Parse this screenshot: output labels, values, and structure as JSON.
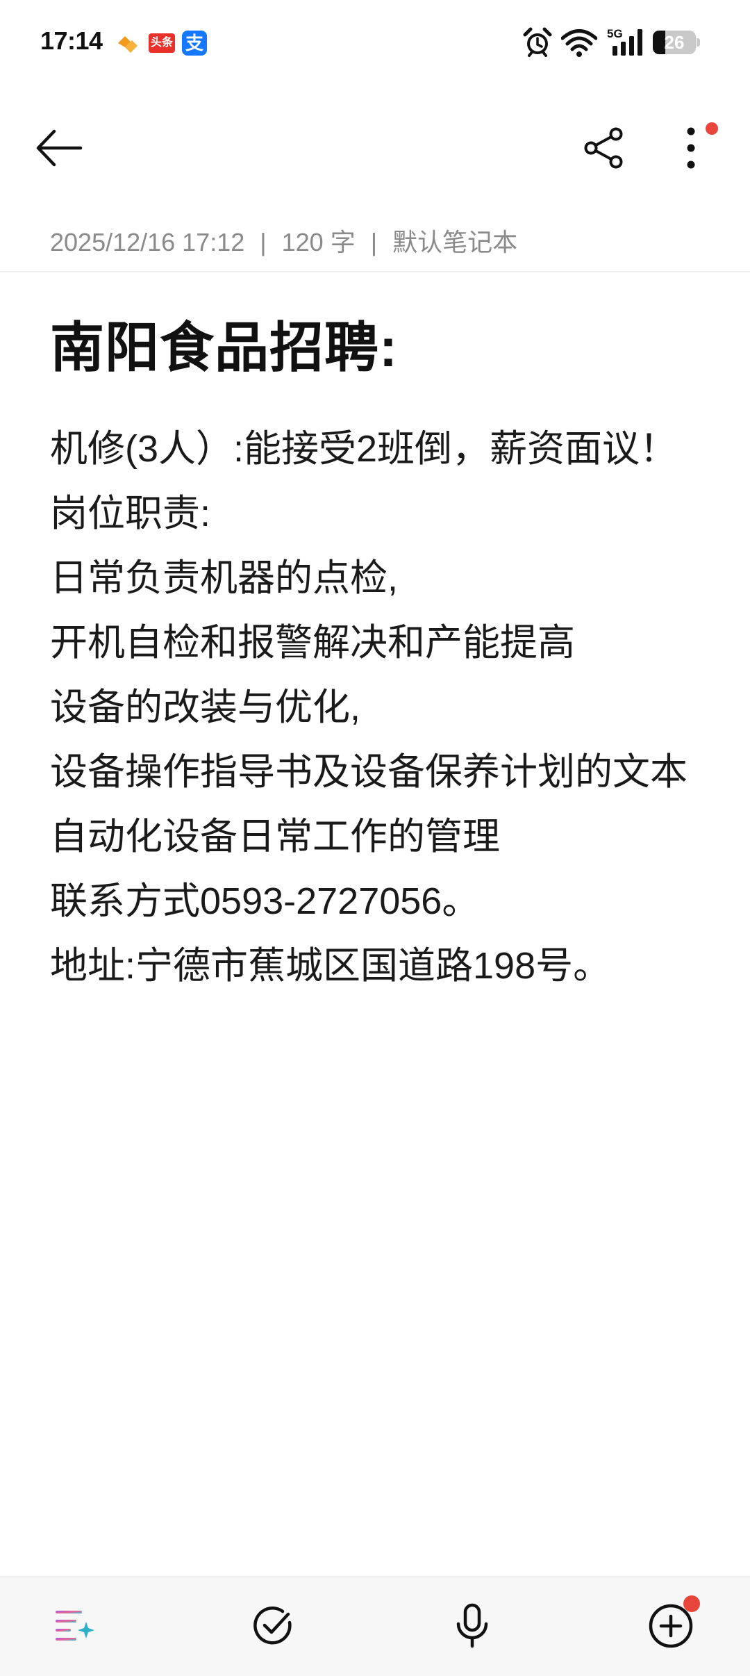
{
  "status_bar": {
    "time": "17:14",
    "app_icons": [
      "huawei-health-icon",
      "toutiao-icon",
      "alipay-icon"
    ],
    "toutiao_label": "头条",
    "alipay_label": "支",
    "network": "5G",
    "battery_level": "26",
    "right_icons": [
      "alarm-icon",
      "wifi-icon",
      "signal-icon",
      "battery-icon"
    ]
  },
  "toolbar": {
    "icons": [
      "back-arrow-icon",
      "share-icon",
      "more-vertical-icon"
    ],
    "more_has_badge": true
  },
  "meta": {
    "datetime": "2025/12/16 17:12",
    "word_count": "120 字",
    "notebook": "默认笔记本",
    "separator": "|"
  },
  "note": {
    "title": "南阳食品招聘:",
    "lines": [
      "机修(3人）:能接受2班倒，薪资面议！",
      "岗位职责:",
      "日常负责机器的点检,",
      "开机自检和报警解决和产能提高",
      "设备的改装与优化,",
      "设备操作指导书及设备保养计划的文本",
      "自动化设备日常工作的管理",
      "联系方式0593-2727056。",
      "地址:宁德市蕉城区国道路198号。"
    ]
  },
  "bottom_bar": {
    "icons": [
      "ai-format-icon",
      "checklist-icon",
      "microphone-icon",
      "add-circle-icon"
    ],
    "add_has_badge": true
  },
  "colors": {
    "accent_red": "#e8453c",
    "meta_gray": "#8a8a8a",
    "text_dark": "#1a1a1a",
    "alipay_blue": "#1677ff",
    "toutiao_red": "#e8312b",
    "health_orange": "#f39a1c"
  }
}
